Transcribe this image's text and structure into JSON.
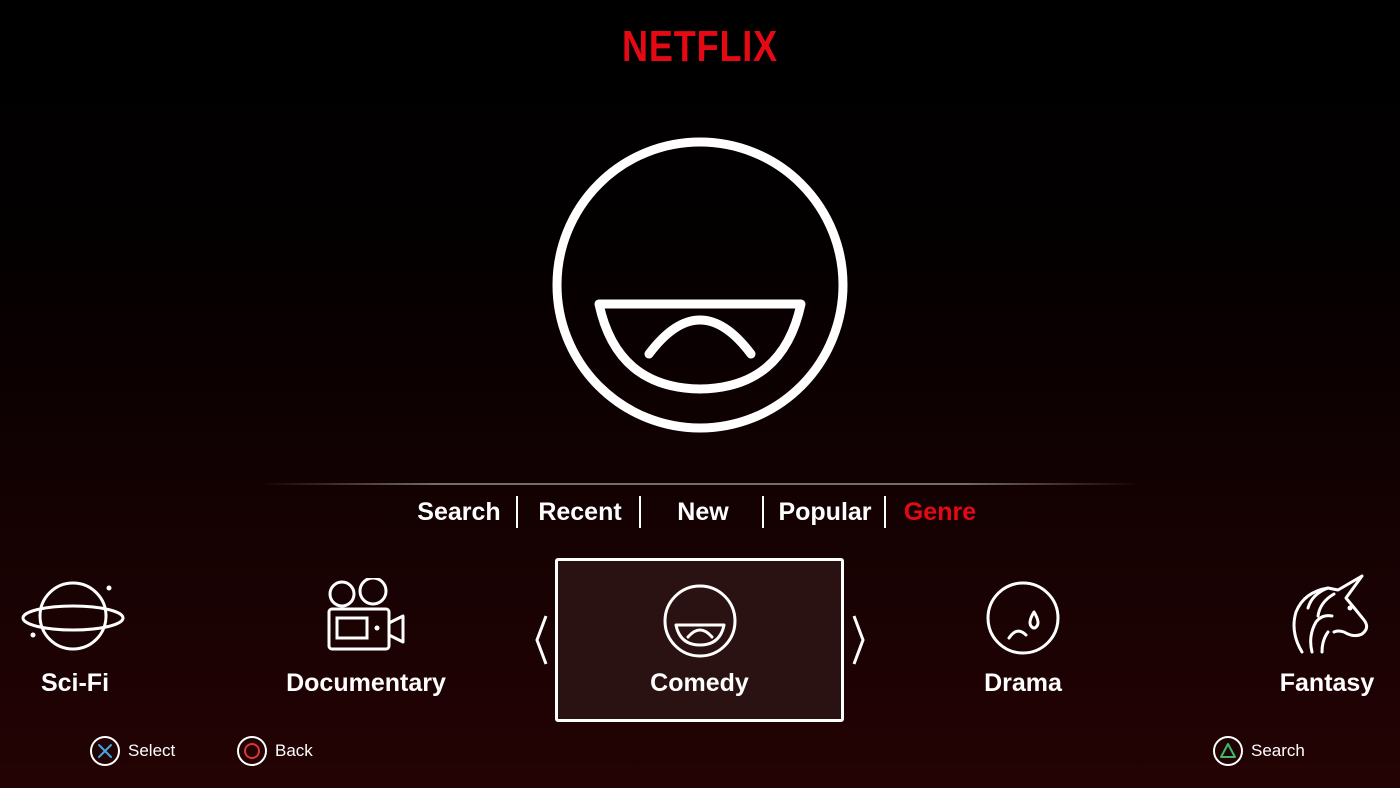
{
  "app": {
    "logo_text": "NETFLIX",
    "brand_color": "#e50914"
  },
  "hero": {
    "icon": "comedy-face-icon"
  },
  "nav": {
    "items": [
      {
        "label": "Search",
        "active": false
      },
      {
        "label": "Recent",
        "active": false
      },
      {
        "label": "New",
        "active": false
      },
      {
        "label": "Popular",
        "active": false
      },
      {
        "label": "Genre",
        "active": true
      }
    ]
  },
  "genres": {
    "items": [
      {
        "label": "Sci-Fi",
        "icon": "planet-icon",
        "selected": false
      },
      {
        "label": "Documentary",
        "icon": "movie-camera-icon",
        "selected": false
      },
      {
        "label": "Comedy",
        "icon": "comedy-face-icon",
        "selected": true
      },
      {
        "label": "Drama",
        "icon": "sad-face-icon",
        "selected": false
      },
      {
        "label": "Fantasy",
        "icon": "unicorn-icon",
        "selected": false
      }
    ],
    "prev_icon": "chevron-left-icon",
    "next_icon": "chevron-right-icon"
  },
  "hints": {
    "select": {
      "label": "Select",
      "icon": "cross-button-icon",
      "color": "#4aa3df"
    },
    "back": {
      "label": "Back",
      "icon": "circle-button-icon",
      "color": "#e0323a"
    },
    "search": {
      "label": "Search",
      "icon": "triangle-button-icon",
      "color": "#3dbb6a"
    }
  }
}
